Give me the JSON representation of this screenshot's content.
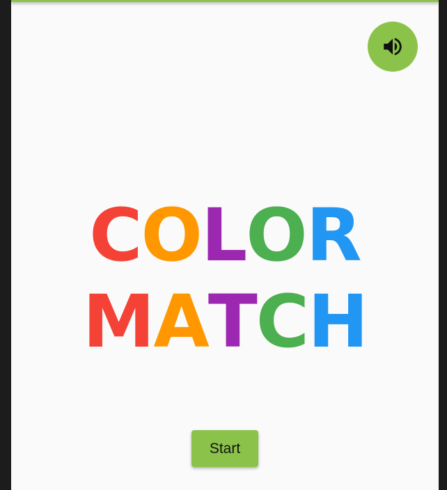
{
  "colors": {
    "accent": "#8bc34a",
    "background": "#fafafa",
    "red": "#f44336",
    "orange": "#ff9800",
    "purple": "#9c27b0",
    "green": "#4caf50",
    "blue": "#2196f3"
  },
  "sound_button": {
    "icon": "volume-up-icon"
  },
  "title": {
    "line1": [
      {
        "char": "C",
        "color": "#f44336"
      },
      {
        "char": "O",
        "color": "#ff9800"
      },
      {
        "char": "L",
        "color": "#9c27b0"
      },
      {
        "char": "O",
        "color": "#4caf50"
      },
      {
        "char": "R",
        "color": "#2196f3"
      }
    ],
    "line2": [
      {
        "char": "M",
        "color": "#f44336"
      },
      {
        "char": "A",
        "color": "#ff9800"
      },
      {
        "char": "T",
        "color": "#9c27b0"
      },
      {
        "char": "C",
        "color": "#4caf50"
      },
      {
        "char": "H",
        "color": "#2196f3"
      }
    ]
  },
  "start_button": {
    "label": "Start"
  }
}
